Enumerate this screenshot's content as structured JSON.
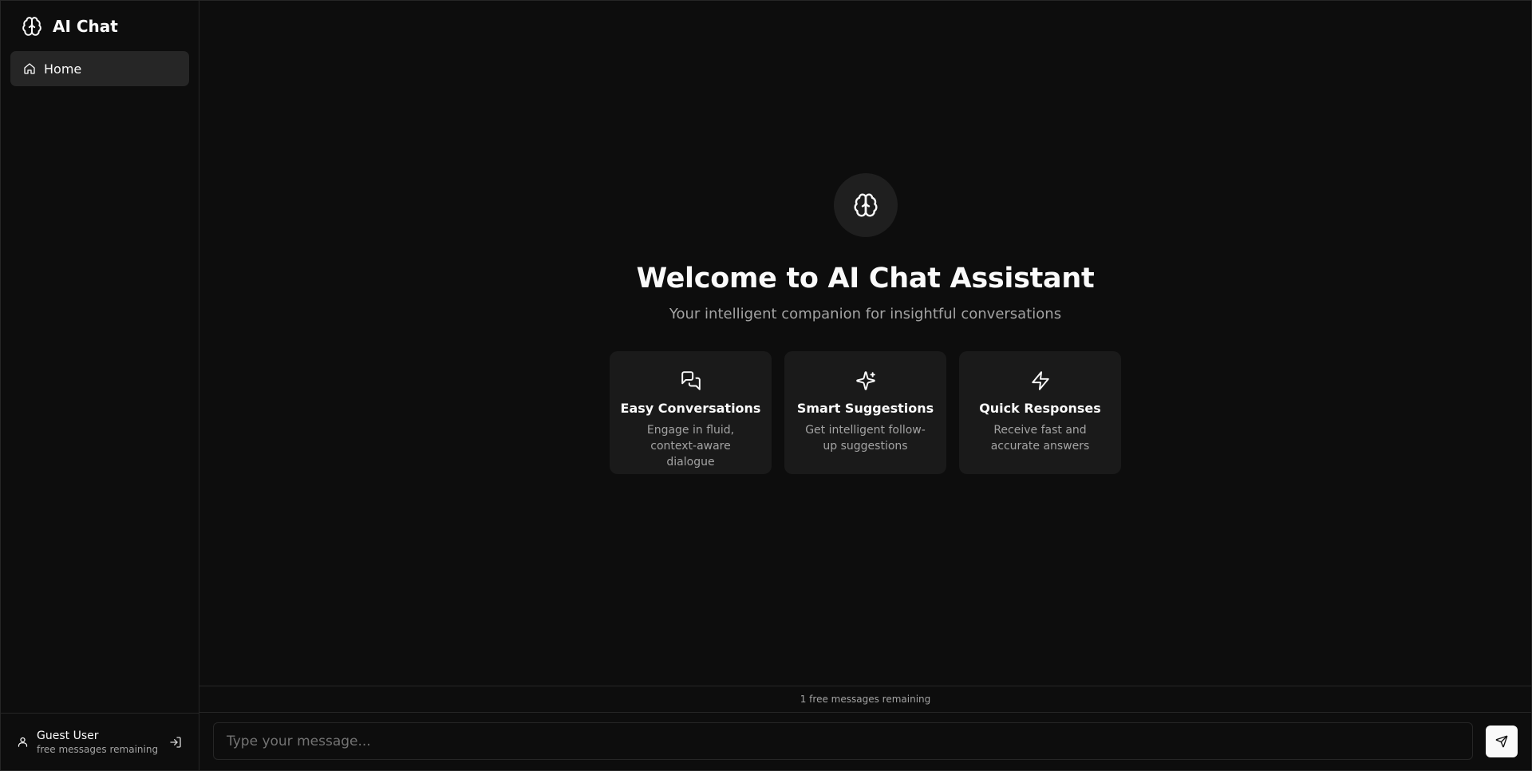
{
  "sidebar": {
    "brand": {
      "name": "AI Chat",
      "icon": "brain-icon"
    },
    "nav": [
      {
        "label": "Home",
        "icon": "home-icon",
        "active": true
      }
    ],
    "footer": {
      "user_name": "Guest User",
      "user_sub": "free messages remaining",
      "user_icon": "user-icon",
      "login_icon": "log-in-icon"
    }
  },
  "welcome": {
    "icon": "brain-icon",
    "title": "Welcome to AI Chat Assistant",
    "subtitle": "Your intelligent companion for insightful conversations",
    "cards": [
      {
        "icon": "chat-bubbles-icon",
        "title": "Easy Conversations",
        "desc": "Engage in fluid, context-aware dialogue"
      },
      {
        "icon": "sparkles-icon",
        "title": "Smart Suggestions",
        "desc": "Get intelligent follow-up suggestions"
      },
      {
        "icon": "lightning-icon",
        "title": "Quick Responses",
        "desc": "Receive fast and accurate answers"
      }
    ]
  },
  "composer": {
    "remaining_text": "1 free messages remaining",
    "placeholder": "Type your message...",
    "send_icon": "send-icon"
  },
  "colors": {
    "background": "#0d0d0d",
    "surface": "#1a1a1a",
    "border": "#262626",
    "text": "#fafafa",
    "muted": "#a3a3a3"
  }
}
